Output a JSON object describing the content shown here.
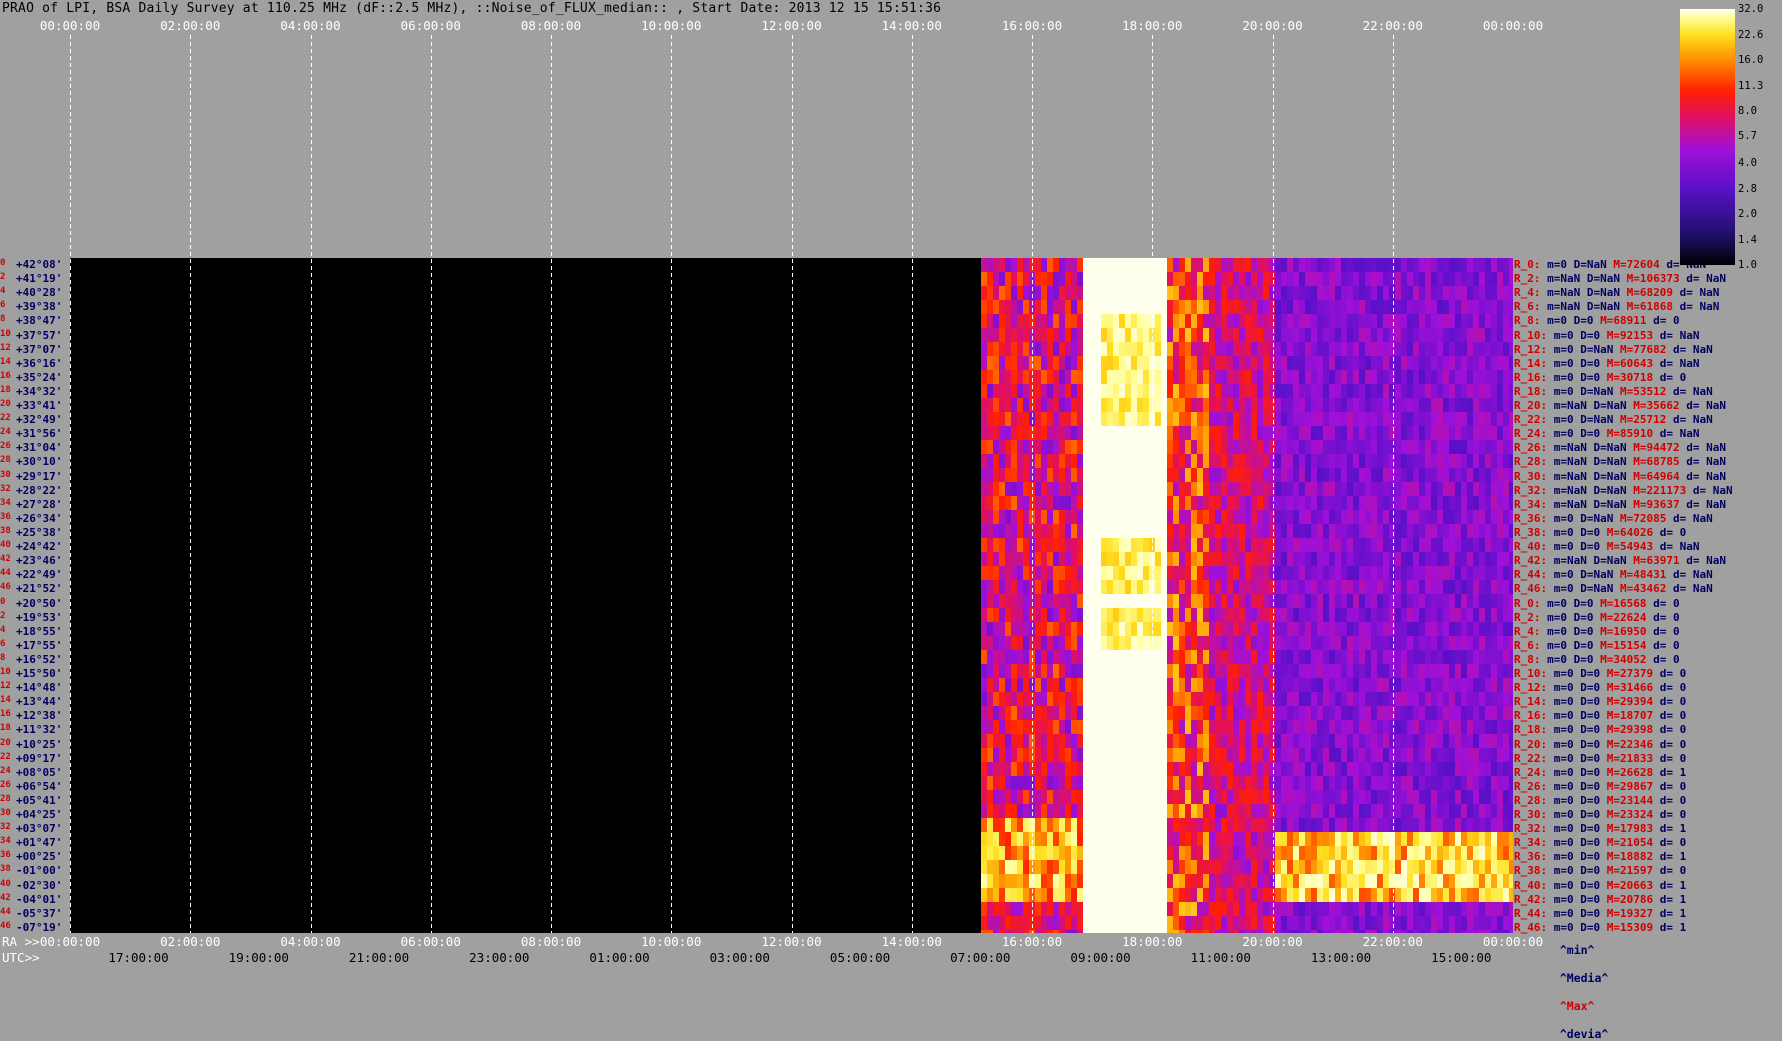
{
  "title": "PRAO of LPI, BSA Daily Survey at 110.25 MHz (dF::2.5 MHz), ::Noise_of_FLUX_median:: , Start Date: 2013 12 15 15:51:36",
  "chart_data": {
    "type": "heatmap",
    "title": "PRAO of LPI, BSA Daily Survey at 110.25 MHz (dF::2.5 MHz), ::Noise_of_FLUX_median:: , Start Date: 2013 12 15 15:51:36",
    "top_axis_ticks": [
      "00:00:00",
      "02:00:00",
      "04:00:00",
      "06:00:00",
      "08:00:00",
      "10:00:00",
      "12:00:00",
      "14:00:00",
      "16:00:00",
      "18:00:00",
      "20:00:00",
      "22:00:00",
      "00:00:00"
    ],
    "ra_prefix": "RA >>",
    "ra_ticks": [
      "00:00:00",
      "02:00:00",
      "04:00:00",
      "06:00:00",
      "08:00:00",
      "10:00:00",
      "12:00:00",
      "14:00:00",
      "16:00:00",
      "18:00:00",
      "20:00:00",
      "22:00:00",
      "00:00:00"
    ],
    "utc_prefix": "UTC>>",
    "utc_ticks": [
      "17:00:00",
      "19:00:00",
      "21:00:00",
      "23:00:00",
      "01:00:00",
      "03:00:00",
      "05:00:00",
      "07:00:00",
      "09:00:00",
      "11:00:00",
      "13:00:00",
      "15:00:00"
    ],
    "colorbar_ticks": [
      "32.0",
      "22.6",
      "16.0",
      "11.3",
      "8.0",
      "5.7",
      "4.0",
      "2.8",
      "2.0",
      "1.4",
      "1.0"
    ],
    "colors": {
      "background": "#a0a0a0",
      "no_data": "#000000",
      "plot_area": "#a0a0a0",
      "label_red": "#d00000",
      "label_navy": "#000060",
      "grid": "#ffffff"
    },
    "declinations": [
      {
        "idx": "0",
        "dec": "+42°08'"
      },
      {
        "idx": "2",
        "dec": "+41°19'"
      },
      {
        "idx": "4",
        "dec": "+40°28'"
      },
      {
        "idx": "6",
        "dec": "+39°38'"
      },
      {
        "idx": "8",
        "dec": "+38°47'"
      },
      {
        "idx": "10",
        "dec": "+37°57'"
      },
      {
        "idx": "12",
        "dec": "+37°07'"
      },
      {
        "idx": "14",
        "dec": "+36°16'"
      },
      {
        "idx": "16",
        "dec": "+35°24'"
      },
      {
        "idx": "18",
        "dec": "+34°32'"
      },
      {
        "idx": "20",
        "dec": "+33°41'"
      },
      {
        "idx": "22",
        "dec": "+32°49'"
      },
      {
        "idx": "24",
        "dec": "+31°56'"
      },
      {
        "idx": "26",
        "dec": "+31°04'"
      },
      {
        "idx": "28",
        "dec": "+30°10'"
      },
      {
        "idx": "30",
        "dec": "+29°17'"
      },
      {
        "idx": "32",
        "dec": "+28°22'"
      },
      {
        "idx": "34",
        "dec": "+27°28'"
      },
      {
        "idx": "36",
        "dec": "+26°34'"
      },
      {
        "idx": "38",
        "dec": "+25°38'"
      },
      {
        "idx": "40",
        "dec": "+24°42'"
      },
      {
        "idx": "42",
        "dec": "+23°46'"
      },
      {
        "idx": "44",
        "dec": "+22°49'"
      },
      {
        "idx": "46",
        "dec": "+21°52'"
      },
      {
        "idx": "0",
        "dec": "+20°50'"
      },
      {
        "idx": "2",
        "dec": "+19°53'"
      },
      {
        "idx": "4",
        "dec": "+18°55'"
      },
      {
        "idx": "6",
        "dec": "+17°55'"
      },
      {
        "idx": "8",
        "dec": "+16°52'"
      },
      {
        "idx": "10",
        "dec": "+15°50'"
      },
      {
        "idx": "12",
        "dec": "+14°48'"
      },
      {
        "idx": "14",
        "dec": "+13°44'"
      },
      {
        "idx": "16",
        "dec": "+12°38'"
      },
      {
        "idx": "18",
        "dec": "+11°32'"
      },
      {
        "idx": "20",
        "dec": "+10°25'"
      },
      {
        "idx": "22",
        "dec": "+09°17'"
      },
      {
        "idx": "24",
        "dec": "+08°05'"
      },
      {
        "idx": "26",
        "dec": "+06°54'"
      },
      {
        "idx": "28",
        "dec": "+05°41'"
      },
      {
        "idx": "30",
        "dec": "+04°25'"
      },
      {
        "idx": "32",
        "dec": "+03°07'"
      },
      {
        "idx": "34",
        "dec": "+01°47'"
      },
      {
        "idx": "36",
        "dec": "+00°25'"
      },
      {
        "idx": "38",
        "dec": "-01°00'"
      },
      {
        "idx": "40",
        "dec": "-02°30'"
      },
      {
        "idx": "42",
        "dec": "-04°01'"
      },
      {
        "idx": "44",
        "dec": "-05°37'"
      },
      {
        "idx": "46",
        "dec": "-07°19'"
      }
    ],
    "receivers": [
      {
        "r": "R_0:",
        "m": "m=0",
        "D": "D=NaN",
        "M": "M=72604",
        "d": "d= NaN"
      },
      {
        "r": "R_2:",
        "m": "m=NaN",
        "D": "D=NaN",
        "M": "M=106373",
        "d": "d= NaN"
      },
      {
        "r": "R_4:",
        "m": "m=NaN",
        "D": "D=NaN",
        "M": "M=68209",
        "d": "d= NaN"
      },
      {
        "r": "R_6:",
        "m": "m=NaN",
        "D": "D=NaN",
        "M": "M=61868",
        "d": "d= NaN"
      },
      {
        "r": "R_8:",
        "m": "m=0",
        "D": "D=0",
        "M": "M=68911",
        "d": "d= 0"
      },
      {
        "r": "R_10:",
        "m": "m=0",
        "D": "D=0",
        "M": "M=92153",
        "d": "d= NaN"
      },
      {
        "r": "R_12:",
        "m": "m=0",
        "D": "D=NaN",
        "M": "M=77682",
        "d": "d= NaN"
      },
      {
        "r": "R_14:",
        "m": "m=0",
        "D": "D=0",
        "M": "M=60643",
        "d": "d= NaN"
      },
      {
        "r": "R_16:",
        "m": "m=0",
        "D": "D=0",
        "M": "M=30718",
        "d": "d= 0"
      },
      {
        "r": "R_18:",
        "m": "m=0",
        "D": "D=NaN",
        "M": "M=53512",
        "d": "d= NaN"
      },
      {
        "r": "R_20:",
        "m": "m=NaN",
        "D": "D=NaN",
        "M": "M=35662",
        "d": "d= NaN"
      },
      {
        "r": "R_22:",
        "m": "m=0",
        "D": "D=NaN",
        "M": "M=25712",
        "d": "d= NaN"
      },
      {
        "r": "R_24:",
        "m": "m=0",
        "D": "D=0",
        "M": "M=85910",
        "d": "d= NaN"
      },
      {
        "r": "R_26:",
        "m": "m=NaN",
        "D": "D=NaN",
        "M": "M=94472",
        "d": "d= NaN"
      },
      {
        "r": "R_28:",
        "m": "m=NaN",
        "D": "D=NaN",
        "M": "M=68785",
        "d": "d= NaN"
      },
      {
        "r": "R_30:",
        "m": "m=NaN",
        "D": "D=NaN",
        "M": "M=64964",
        "d": "d= NaN"
      },
      {
        "r": "R_32:",
        "m": "m=NaN",
        "D": "D=NaN",
        "M": "M=221173",
        "d": "d= NaN"
      },
      {
        "r": "R_34:",
        "m": "m=NaN",
        "D": "D=NaN",
        "M": "M=93637",
        "d": "d= NaN"
      },
      {
        "r": "R_36:",
        "m": "m=0",
        "D": "D=NaN",
        "M": "M=72085",
        "d": "d= NaN"
      },
      {
        "r": "R_38:",
        "m": "m=0",
        "D": "D=0",
        "M": "M=64026",
        "d": "d= 0"
      },
      {
        "r": "R_40:",
        "m": "m=0",
        "D": "D=0",
        "M": "M=54943",
        "d": "d= NaN"
      },
      {
        "r": "R_42:",
        "m": "m=NaN",
        "D": "D=NaN",
        "M": "M=63971",
        "d": "d= NaN"
      },
      {
        "r": "R_44:",
        "m": "m=0",
        "D": "D=NaN",
        "M": "M=48431",
        "d": "d= NaN"
      },
      {
        "r": "R_46:",
        "m": "m=0",
        "D": "D=NaN",
        "M": "M=43462",
        "d": "d= NaN"
      },
      {
        "r": "R_0:",
        "m": "m=0",
        "D": "D=0",
        "M": "M=16568",
        "d": "d= 0"
      },
      {
        "r": "R_2:",
        "m": "m=0",
        "D": "D=0",
        "M": "M=22624",
        "d": "d= 0"
      },
      {
        "r": "R_4:",
        "m": "m=0",
        "D": "D=0",
        "M": "M=16950",
        "d": "d= 0"
      },
      {
        "r": "R_6:",
        "m": "m=0",
        "D": "D=0",
        "M": "M=15154",
        "d": "d= 0"
      },
      {
        "r": "R_8:",
        "m": "m=0",
        "D": "D=0",
        "M": "M=34052",
        "d": "d= 0"
      },
      {
        "r": "R_10:",
        "m": "m=0",
        "D": "D=0",
        "M": "M=27379",
        "d": "d= 0"
      },
      {
        "r": "R_12:",
        "m": "m=0",
        "D": "D=0",
        "M": "M=31466",
        "d": "d= 0"
      },
      {
        "r": "R_14:",
        "m": "m=0",
        "D": "D=0",
        "M": "M=29394",
        "d": "d= 0"
      },
      {
        "r": "R_16:",
        "m": "m=0",
        "D": "D=0",
        "M": "M=18707",
        "d": "d= 0"
      },
      {
        "r": "R_18:",
        "m": "m=0",
        "D": "D=0",
        "M": "M=29398",
        "d": "d= 0"
      },
      {
        "r": "R_20:",
        "m": "m=0",
        "D": "D=0",
        "M": "M=22346",
        "d": "d= 0"
      },
      {
        "r": "R_22:",
        "m": "m=0",
        "D": "D=0",
        "M": "M=21833",
        "d": "d= 0"
      },
      {
        "r": "R_24:",
        "m": "m=0",
        "D": "D=0",
        "M": "M=26628",
        "d": "d= 1"
      },
      {
        "r": "R_26:",
        "m": "m=0",
        "D": "D=0",
        "M": "M=29867",
        "d": "d= 0"
      },
      {
        "r": "R_28:",
        "m": "m=0",
        "D": "D=0",
        "M": "M=23144",
        "d": "d= 0"
      },
      {
        "r": "R_30:",
        "m": "m=0",
        "D": "D=0",
        "M": "M=23324",
        "d": "d= 0"
      },
      {
        "r": "R_32:",
        "m": "m=0",
        "D": "D=0",
        "M": "M=17983",
        "d": "d= 1"
      },
      {
        "r": "R_34:",
        "m": "m=0",
        "D": "D=0",
        "M": "M=21054",
        "d": "d= 0"
      },
      {
        "r": "R_36:",
        "m": "m=0",
        "D": "D=0",
        "M": "M=18882",
        "d": "d= 1"
      },
      {
        "r": "R_38:",
        "m": "m=0",
        "D": "D=0",
        "M": "M=21597",
        "d": "d= 0"
      },
      {
        "r": "R_40:",
        "m": "m=0",
        "D": "D=0",
        "M": "M=20663",
        "d": "d= 1"
      },
      {
        "r": "R_42:",
        "m": "m=0",
        "D": "D=0",
        "M": "M=20786",
        "d": "d= 1"
      },
      {
        "r": "R_44:",
        "m": "m=0",
        "D": "D=0",
        "M": "M=19327",
        "d": "d= 1"
      },
      {
        "r": "R_46:",
        "m": "m=0",
        "D": "D=0",
        "M": "M=15309",
        "d": "d= 1"
      }
    ],
    "legend": {
      "min": "^min^",
      "median": "^Media^",
      "max": "^Max^",
      "deviation": "^devia^"
    }
  }
}
